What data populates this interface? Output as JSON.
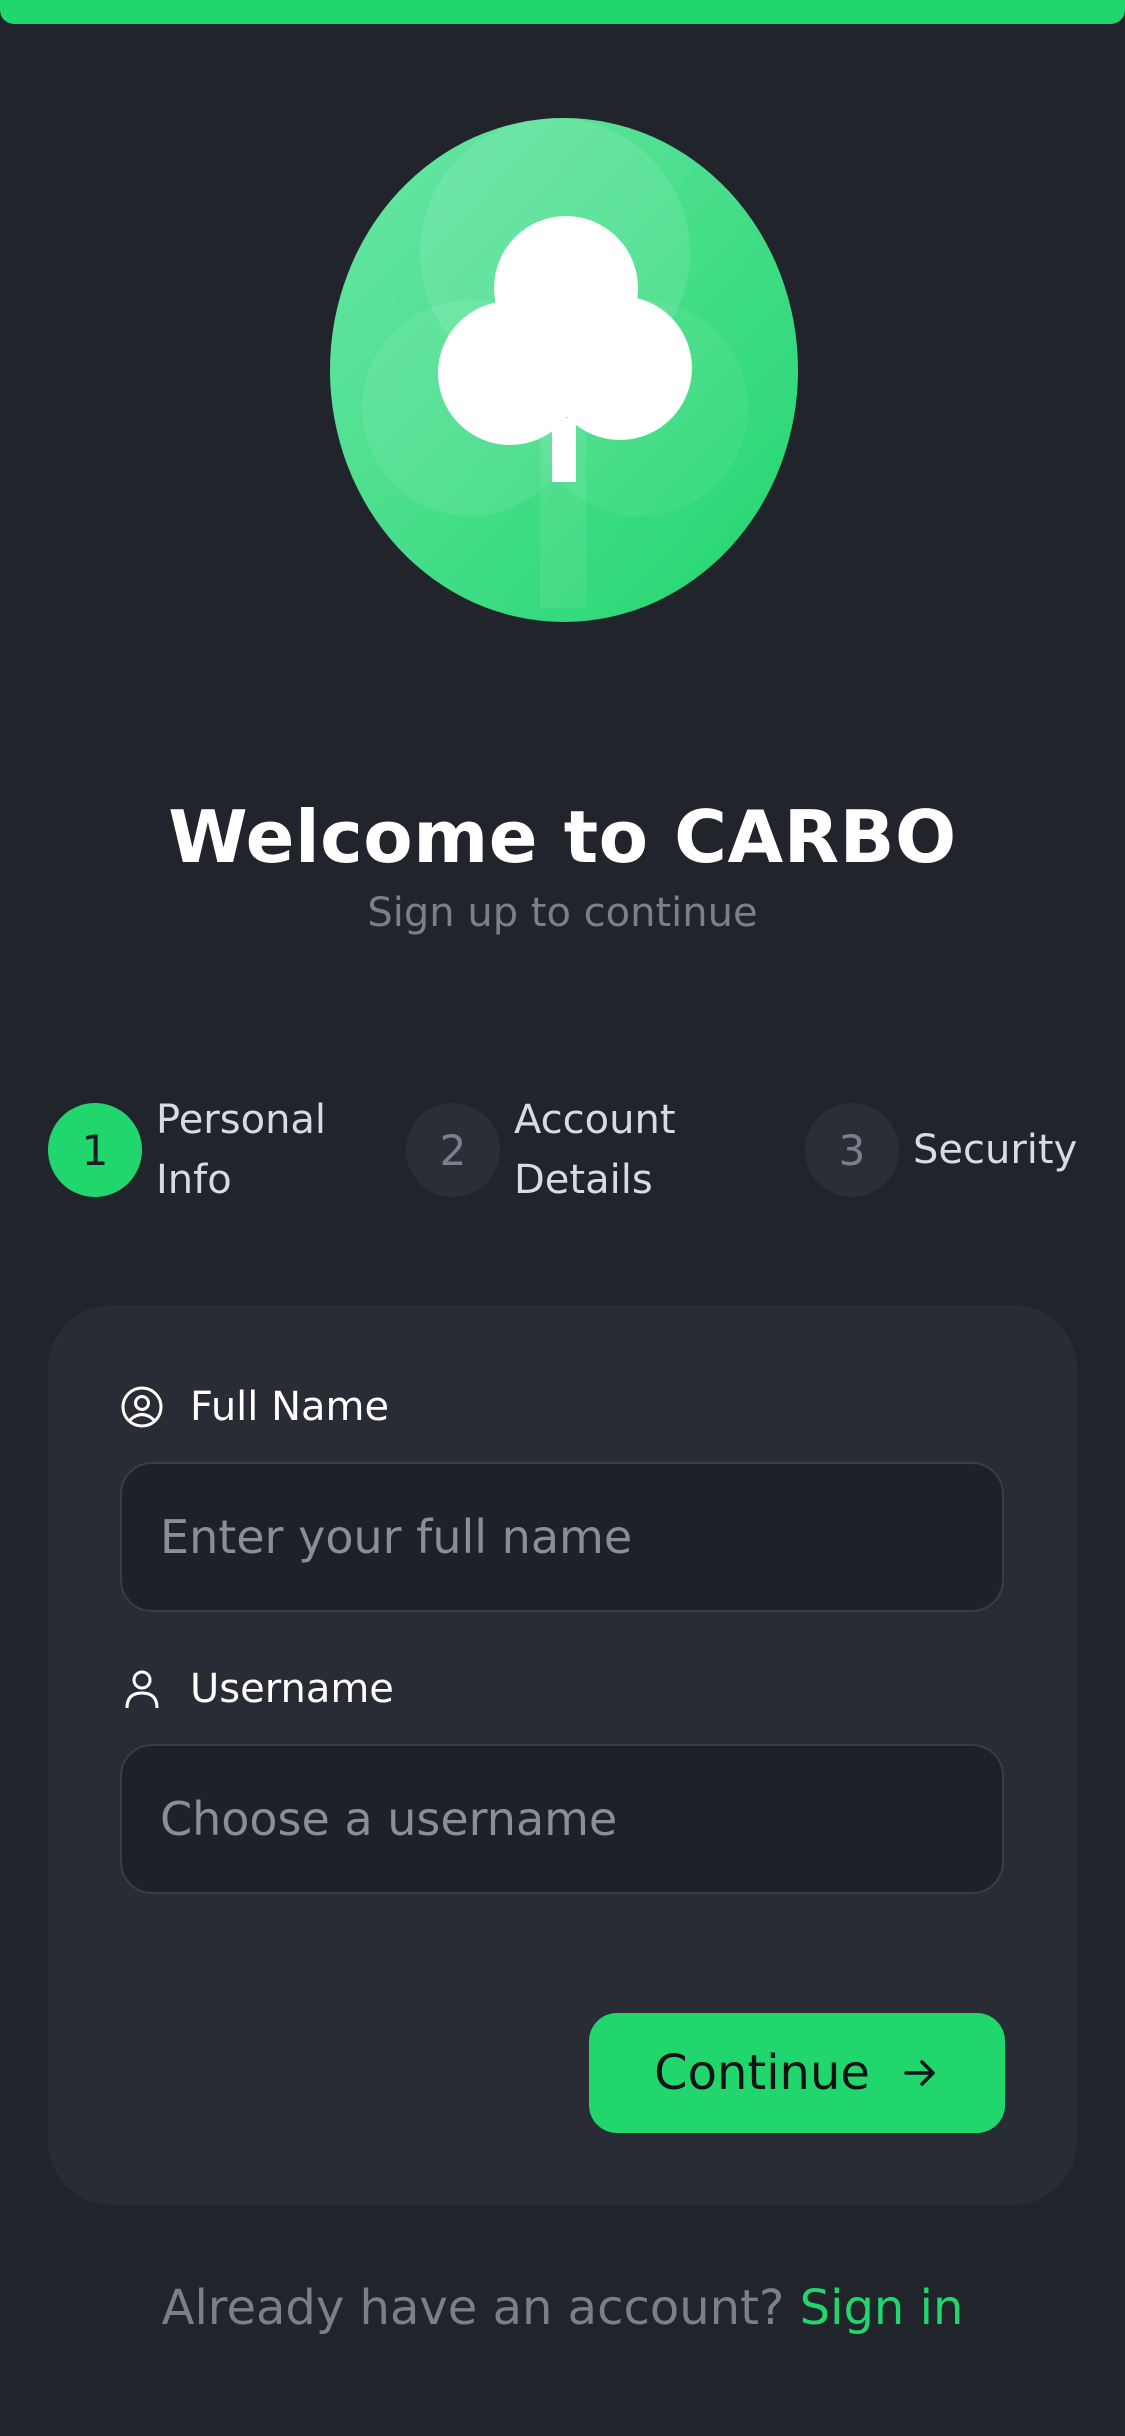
{
  "colors": {
    "accent": "#22d66e",
    "background": "#22242c",
    "card": "#2a2c35",
    "input_bg": "#1f2128",
    "muted_text": "#7b7f8c"
  },
  "header": {
    "title": "Welcome to CARBO",
    "subtitle": "Sign up to continue"
  },
  "stepper": {
    "steps": [
      {
        "number": "1",
        "label": "Personal Info",
        "state": "active"
      },
      {
        "number": "2",
        "label": "Account Details",
        "state": "inactive"
      },
      {
        "number": "3",
        "label": "Security",
        "state": "inactive"
      }
    ]
  },
  "form": {
    "full_name": {
      "label": "Full Name",
      "icon": "user-circle-icon",
      "value": "",
      "placeholder": "Enter your full name"
    },
    "username": {
      "label": "Username",
      "icon": "user-icon",
      "value": "",
      "placeholder": "Choose a username"
    },
    "continue_label": "Continue",
    "continue_icon": "arrow-right-icon"
  },
  "footer": {
    "prompt": "Already have an account?",
    "link_label": "Sign in"
  }
}
